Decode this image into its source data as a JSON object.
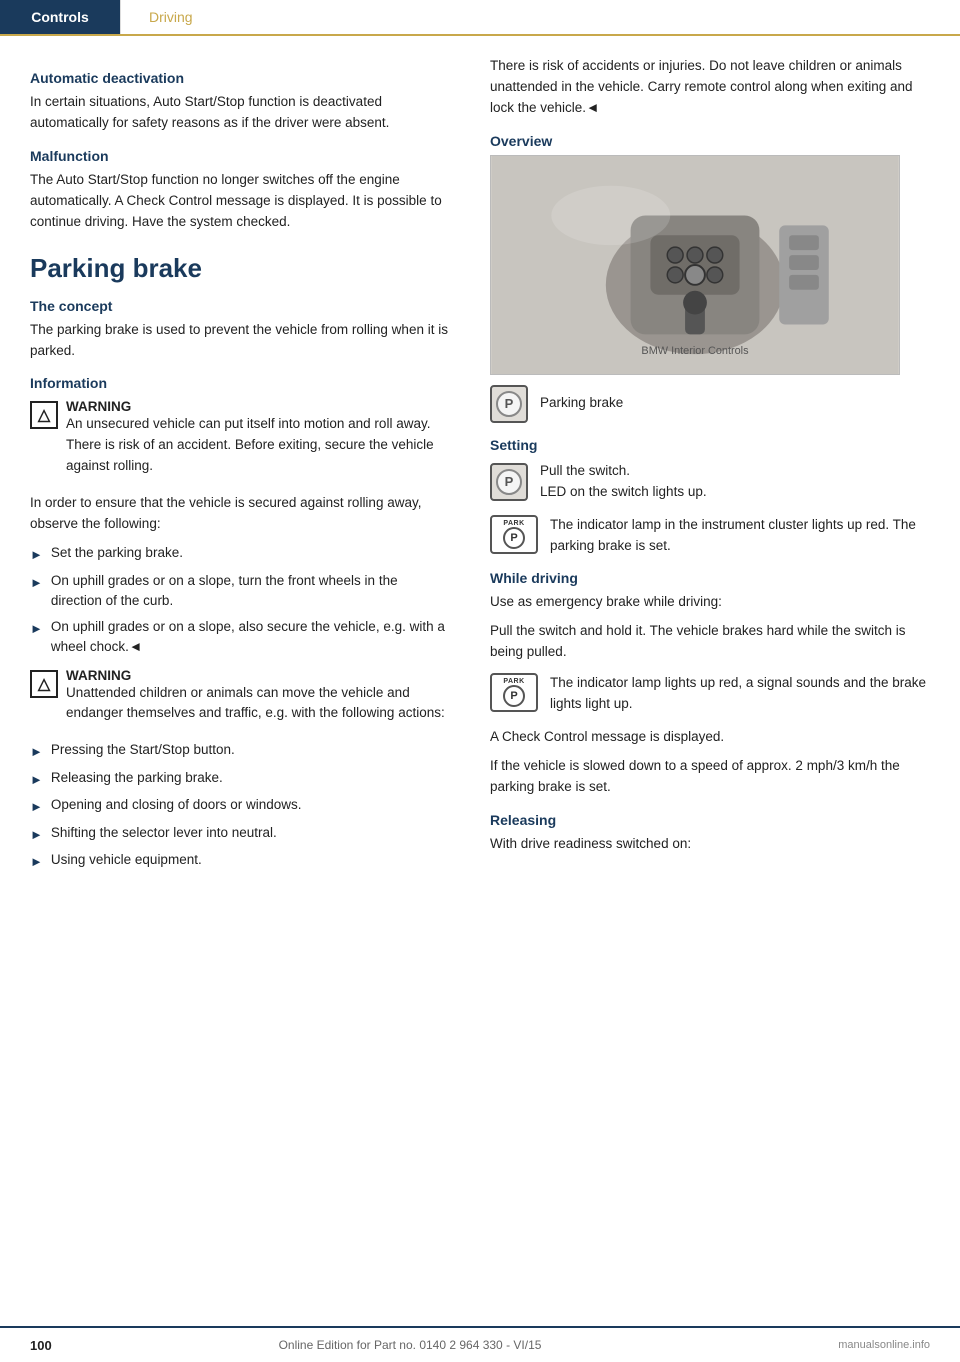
{
  "tabs": {
    "controls_label": "Controls",
    "driving_label": "Driving"
  },
  "left_col": {
    "auto_deactivation_heading": "Automatic deactivation",
    "auto_deactivation_text": "In certain situations, Auto Start/Stop function is deactivated automatically for safety reasons as if the driver were absent.",
    "malfunction_heading": "Malfunction",
    "malfunction_text": "The Auto Start/Stop function no longer switches off the engine automatically. A Check Control message is displayed. It is possible to continue driving. Have the system checked.",
    "parking_brake_heading": "Parking brake",
    "the_concept_heading": "The concept",
    "the_concept_text": "The parking brake is used to prevent the vehicle from rolling when it is parked.",
    "information_heading": "Information",
    "warning1_title": "WARNING",
    "warning1_text": "An unsecured vehicle can put itself into motion and roll away. There is risk of an accident. Before exiting, secure the vehicle against rolling.",
    "info_text": "In order to ensure that the vehicle is secured against rolling away, observe the following:",
    "bullets1": [
      "Set the parking brake.",
      "On uphill grades or on a slope, turn the front wheels in the direction of the curb.",
      "On uphill grades or on a slope, also secure the vehicle, e.g. with a wheel chock.◄"
    ],
    "warning2_title": "WARNING",
    "warning2_text": "Unattended children or animals can move the vehicle and endanger themselves and traffic, e.g. with the following actions:",
    "bullets2": [
      "Pressing the Start/Stop button.",
      "Releasing the parking brake.",
      "Opening and closing of doors or windows.",
      "Shifting the selector lever into neutral.",
      "Using vehicle equipment."
    ]
  },
  "right_col": {
    "risk_text": "There is risk of accidents or injuries. Do not leave children or animals unattended in the vehicle. Carry remote control along when exiting and lock the vehicle.◄",
    "overview_heading": "Overview",
    "parking_brake_label": "Parking brake",
    "setting_heading": "Setting",
    "setting_text1": "Pull the switch.",
    "setting_text2": "LED on the switch lights up.",
    "setting_indicator_text": "The indicator lamp in the instrument cluster lights up red. The parking brake is set.",
    "while_driving_heading": "While driving",
    "while_driving_text1": "Use as emergency brake while driving:",
    "while_driving_text2": "Pull the switch and hold it. The vehicle brakes hard while the switch is being pulled.",
    "while_driving_indicator": "The indicator lamp lights up red, a signal sounds and the brake lights light up.",
    "check_control_text": "A Check Control message is displayed.",
    "slow_down_text": "If the vehicle is slowed down to a speed of approx. 2 mph/3 km/h the parking brake is set.",
    "releasing_heading": "Releasing",
    "releasing_text": "With drive readiness switched on:"
  },
  "footer": {
    "page_number": "100",
    "center_text": "Online Edition for Part no. 0140 2 964 330 - VI/15",
    "right_text": "manualsonline.info"
  }
}
